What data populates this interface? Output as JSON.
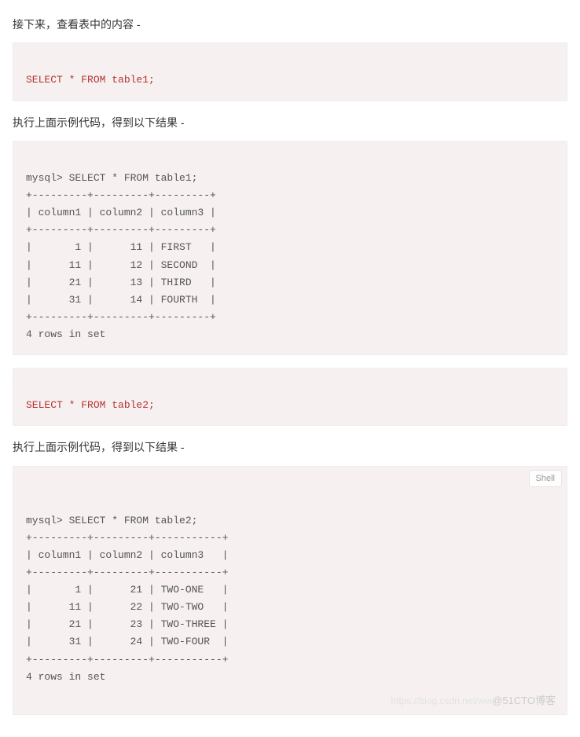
{
  "intro_text": "接下来，查看表中的内容 -",
  "sql1": "SELECT * FROM table1;",
  "result_intro1": "执行上面示例代码，得到以下结果 -",
  "output1": "mysql> SELECT * FROM table1;\n+---------+---------+---------+\n| column1 | column2 | column3 |\n+---------+---------+---------+\n|       1 |      11 | FIRST   |\n|      11 |      12 | SECOND  |\n|      21 |      13 | THIRD   |\n|      31 |      14 | FOURTH  |\n+---------+---------+---------+\n4 rows in set",
  "sql2": "SELECT * FROM table2;",
  "result_intro2": "执行上面示例代码，得到以下结果 -",
  "output2": "mysql> SELECT * FROM table2;\n+---------+---------+-----------+\n| column1 | column2 | column3   |\n+---------+---------+-----------+\n|       1 |      21 | TWO-ONE   |\n|      11 |      22 | TWO-TWO   |\n|      21 |      23 | TWO-THREE |\n|      31 |      24 | TWO-FOUR  |\n+---------+---------+-----------+\n4 rows in set",
  "lang_tag": "Shell",
  "watermark_main": "@51CTO博客",
  "watermark_faint": "https://blog.csdn.net/wei"
}
